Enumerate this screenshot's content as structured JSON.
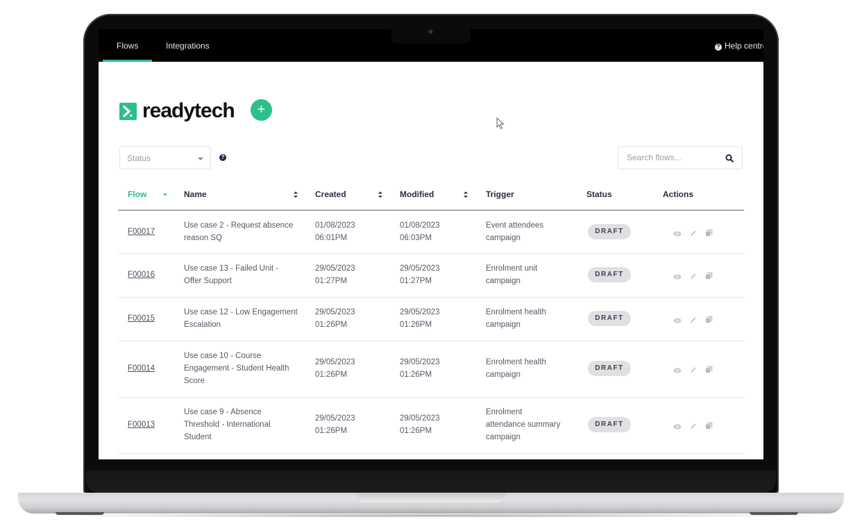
{
  "nav": {
    "tabs": [
      {
        "label": "Flows",
        "active": true
      },
      {
        "label": "Integrations",
        "active": false
      }
    ],
    "help_label": "Help centre",
    "help_icon": "question-circle-icon"
  },
  "brand": {
    "name": "readytech",
    "color": "#2bbf8a",
    "add_label": "+"
  },
  "filters": {
    "status_placeholder": "Status",
    "status_help_icon": "question-circle-icon",
    "search_placeholder": "Search flows...",
    "search_value": ""
  },
  "table": {
    "columns": [
      "Flow",
      "Name",
      "Created",
      "Modified",
      "Trigger",
      "Status",
      "Actions"
    ],
    "rows": [
      {
        "id": "F00017",
        "name": "Use case 2 - Request absence reason SQ",
        "name_lines": [
          "Use case 2 - Request absence",
          "reason SQ"
        ],
        "created_date": "01/08/2023",
        "created_time": "06:01PM",
        "modified_date": "01/08/2023",
        "modified_time": "06:03PM",
        "trigger_lines": [
          "Event attendees",
          "campaign"
        ],
        "status": "DRAFT"
      },
      {
        "id": "F00016",
        "name": "Use case 13 - Failed Unit - Offer Support",
        "name_lines": [
          "Use case 13 - Failed Unit -",
          "Offer Support"
        ],
        "created_date": "29/05/2023",
        "created_time": "01:27PM",
        "modified_date": "29/05/2023",
        "modified_time": "01:27PM",
        "trigger_lines": [
          "Enrolment unit",
          "campaign"
        ],
        "status": "DRAFT"
      },
      {
        "id": "F00015",
        "name": "Use case 12 - Low Engagement Escalation",
        "name_lines": [
          "Use case 12 - Low Engagement",
          "Escalation"
        ],
        "created_date": "29/05/2023",
        "created_time": "01:26PM",
        "modified_date": "29/05/2023",
        "modified_time": "01:26PM",
        "trigger_lines": [
          "Enrolment health",
          "campaign"
        ],
        "status": "DRAFT"
      },
      {
        "id": "F00014",
        "name": "Use case 10 - Course Engagement - Student Health Score",
        "name_lines": [
          "Use case 10 - Course",
          "Engagement - Student Health",
          "Score"
        ],
        "created_date": "29/05/2023",
        "created_time": "01:26PM",
        "modified_date": "29/05/2023",
        "modified_time": "01:26PM",
        "trigger_lines": [
          "Enrolment health",
          "campaign"
        ],
        "status": "DRAFT"
      },
      {
        "id": "F00013",
        "name": "Use case 9 - Absence Threshold - International Student",
        "name_lines": [
          "Use case 9 - Absence",
          "Threshold - International",
          "Student"
        ],
        "created_date": "29/05/2023",
        "created_time": "01:26PM",
        "modified_date": "29/05/2023",
        "modified_time": "01:26PM",
        "trigger_lines": [
          "Enrolment",
          "attendance summary",
          "campaign"
        ],
        "status": "DRAFT"
      }
    ],
    "row_actions": [
      "view",
      "edit",
      "duplicate"
    ]
  },
  "colors": {
    "accent": "#2bbf8a",
    "topbar": "#000000",
    "badge_bg": "#e0e0e2",
    "header_text": "#2a2d40"
  }
}
